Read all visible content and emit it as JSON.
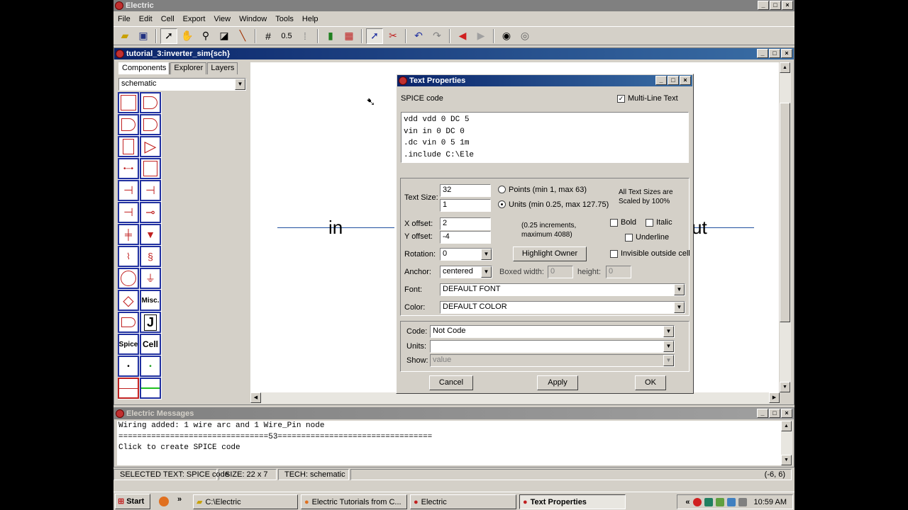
{
  "app": {
    "title": "Electric"
  },
  "menu": [
    "File",
    "Edit",
    "Cell",
    "Export",
    "View",
    "Window",
    "Tools",
    "Help"
  ],
  "toolbar": {
    "scale_value": "0.5"
  },
  "cell_window": {
    "title": "tutorial_3:inverter_sim{sch}",
    "tabs": [
      "Components",
      "Explorer",
      "Layers"
    ],
    "technology": "schematic",
    "palette_labels": {
      "misc": "Misc.",
      "spice": "Spice",
      "cell": "Cell",
      "j": "J"
    },
    "canvas_text": {
      "in": "in",
      "out": "ut"
    }
  },
  "dialog": {
    "title": "Text Properties",
    "heading": "SPICE code",
    "multiline_label": "Multi-Line Text",
    "text_lines": [
      "vdd vdd 0 DC 5",
      "vin in 0 DC 0",
      ".dc vin 0 5 1m",
      ".include C:\\Ele"
    ],
    "text_size_label": "Text Size:",
    "text_size_points": "32",
    "text_size_units": "1",
    "points_label": "Points (min 1, max 63)",
    "units_label": "Units (min 0.25, max 127.75)",
    "scaled_note_1": "All Text Sizes are",
    "scaled_note_2": "Scaled by 100%",
    "x_offset_label": "X offset:",
    "x_offset": "2",
    "y_offset_label": "Y offset:",
    "y_offset": "-4",
    "increments_note_1": "(0.25 increments,",
    "increments_note_2": "maximum 4088)",
    "bold_label": "Bold",
    "italic_label": "Italic",
    "underline_label": "Underline",
    "rotation_label": "Rotation:",
    "rotation": "0",
    "highlight_owner": "Highlight Owner",
    "invisible_label": "Invisible outside cell",
    "anchor_label": "Anchor:",
    "anchor": "centered",
    "boxed_width_label": "Boxed width:",
    "boxed_width": "0",
    "height_label": "height:",
    "height": "0",
    "font_label": "Font:",
    "font": "DEFAULT FONT",
    "color_label": "Color:",
    "color": "DEFAULT COLOR",
    "code_label": "Code:",
    "code": "Not Code",
    "units_field_label": "Units:",
    "units_field": "",
    "show_label": "Show:",
    "show": "value",
    "cancel": "Cancel",
    "apply": "Apply",
    "ok": "OK"
  },
  "messages": {
    "title": "Electric Messages",
    "lines": [
      "Wiring added: 1 wire arc and 1 Wire_Pin node",
      "================================53=================================",
      "Click to create SPICE code"
    ]
  },
  "status": {
    "selected": "SELECTED TEXT: SPICE code",
    "size": "SIZE: 22 x 7",
    "tech": "TECH: schematic",
    "coords": "(-6, 6)"
  },
  "taskbar": {
    "start": "Start",
    "chevron": "»",
    "tasks": [
      "C:\\Electric",
      "Electric Tutorials from C...",
      "Electric",
      "Text Properties"
    ],
    "tray_chevron": "«",
    "clock": "10:59 AM"
  },
  "colors": {
    "title_active": "#0a246a",
    "palette_border": "#2030a0",
    "wire": "#2050a0",
    "icon_red": "#c02020"
  }
}
